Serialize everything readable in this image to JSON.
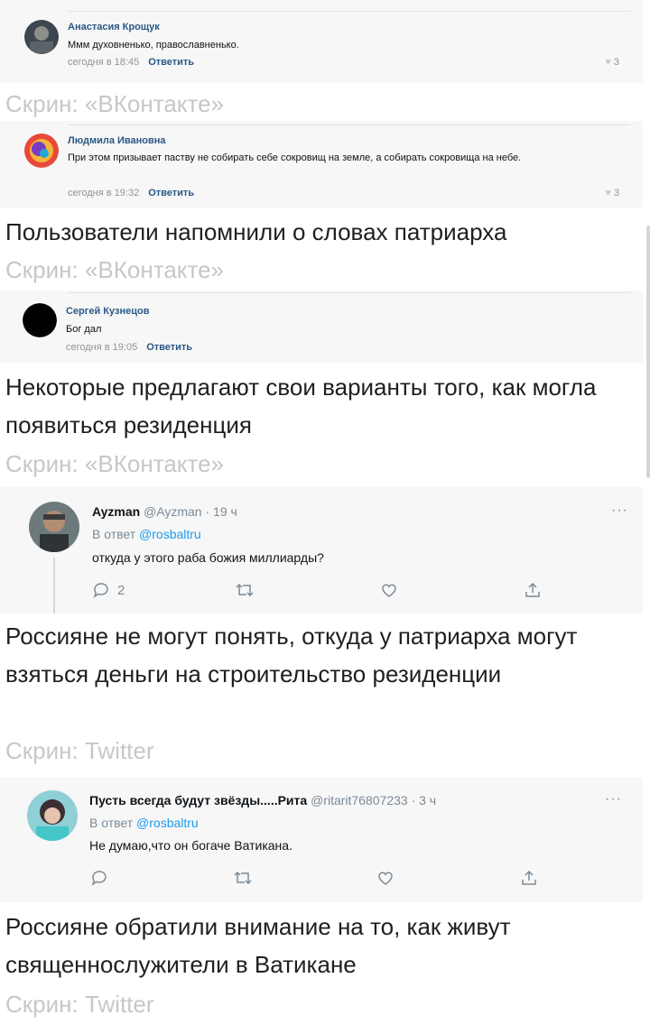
{
  "vk_comments": [
    {
      "author": "Анастасия Крощук",
      "text": "Ммм духовненько, православненько.",
      "time": "сегодня в 18:45",
      "reply_label": "Ответить",
      "likes": "3"
    },
    {
      "author": "Людмила Ивановна",
      "text": "При этом призывает паству не собирать себе сокровищ на земле, а собирать сокровища на небе.",
      "time": "сегодня в 19:32",
      "reply_label": "Ответить",
      "likes": "3"
    },
    {
      "author": "Сергей Кузнецов",
      "text": "Бог дал",
      "time": "сегодня в 19:05",
      "reply_label": "Ответить"
    }
  ],
  "tweets": [
    {
      "name": "Ayzman",
      "handle": "@Ayzman · 19 ч",
      "reply_prefix": "В ответ",
      "reply_mention": "@rosbaltru",
      "text": "откуда у этого раба божия миллиарды?",
      "reply_count": "2",
      "more": "···"
    },
    {
      "name": "Пусть всегда будут звёзды.....Рита",
      "handle": "@ritarit76807233 · 3 ч",
      "reply_prefix": "В ответ",
      "reply_mention": "@rosbaltru",
      "text": "Не думаю,что он богаче Ватикана.",
      "more": "···"
    }
  ],
  "captions": [
    "Пользователи напомнили о словах патриарха",
    "Некоторые предлагают свои варианты того, как могла появиться резиденция",
    "Россияне не могут понять, откуда у патриарха могут взяться деньги на строительство резиденции",
    "Россияне обратили внимание на то, как живут священнослужители в Ватикане"
  ],
  "credits": {
    "vk": "Скрин: «ВКонтакте»",
    "twitter": "Скрин: Twitter"
  },
  "colors": {
    "vk_link": "#2a5885",
    "twitter_blue": "#1d9bf0",
    "credit_gray": "#c7c7c7"
  }
}
